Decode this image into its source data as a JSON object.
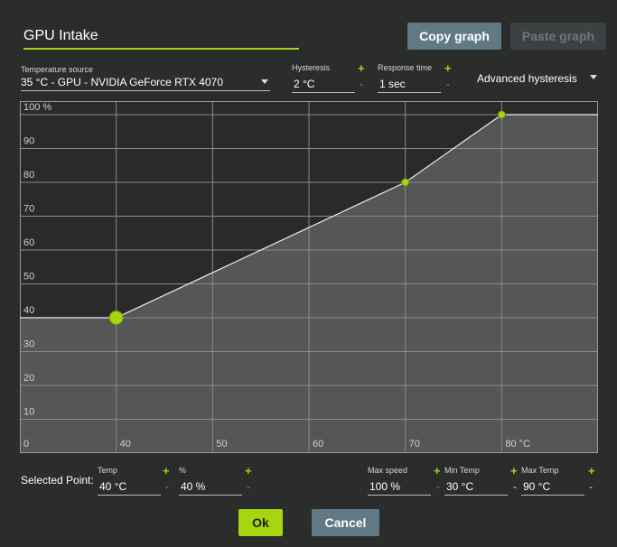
{
  "title": "GPU Intake",
  "buttons": {
    "copy_graph": "Copy graph",
    "paste_graph": "Paste graph",
    "ok": "Ok",
    "cancel": "Cancel"
  },
  "temperature_source": {
    "label": "Temperature source",
    "value": "35 °C - GPU - NVIDIA GeForce RTX 4070"
  },
  "hysteresis": {
    "label": "Hysteresis",
    "value": "2 °C",
    "plus": "+",
    "minus": "-"
  },
  "response_time": {
    "label": "Response time",
    "value": "1 sec",
    "plus": "+",
    "minus": "-"
  },
  "advanced_hysteresis": {
    "label": "Advanced hysteresis"
  },
  "graph": {
    "y_ticks": [
      "100 %",
      "90",
      "80",
      "70",
      "60",
      "50",
      "40",
      "30",
      "20",
      "10"
    ],
    "x_ticks": [
      "0",
      "40",
      "50",
      "60",
      "70",
      "80 °C"
    ],
    "points": [
      {
        "temp": 40,
        "percent": 40,
        "selected": true
      },
      {
        "temp": 70,
        "percent": 80,
        "selected": false
      },
      {
        "temp": 80,
        "percent": 100,
        "selected": false
      }
    ],
    "x_range": [
      30,
      90
    ],
    "y_range": [
      0,
      100
    ]
  },
  "selected_point": {
    "label": "Selected Point:",
    "temp_label": "Temp",
    "temp_value": "40 °C",
    "percent_label": "%",
    "percent_value": "40 %"
  },
  "max_speed": {
    "label": "Max speed",
    "value": "100 %"
  },
  "min_temp": {
    "label": "Min Temp",
    "value": "30 °C"
  },
  "max_temp": {
    "label": "Max Temp",
    "value": "90 °C"
  },
  "colors": {
    "accent": "#a6d60f",
    "button": "#607985",
    "background": "#2b2c2c",
    "graph_fill": "#555656"
  }
}
